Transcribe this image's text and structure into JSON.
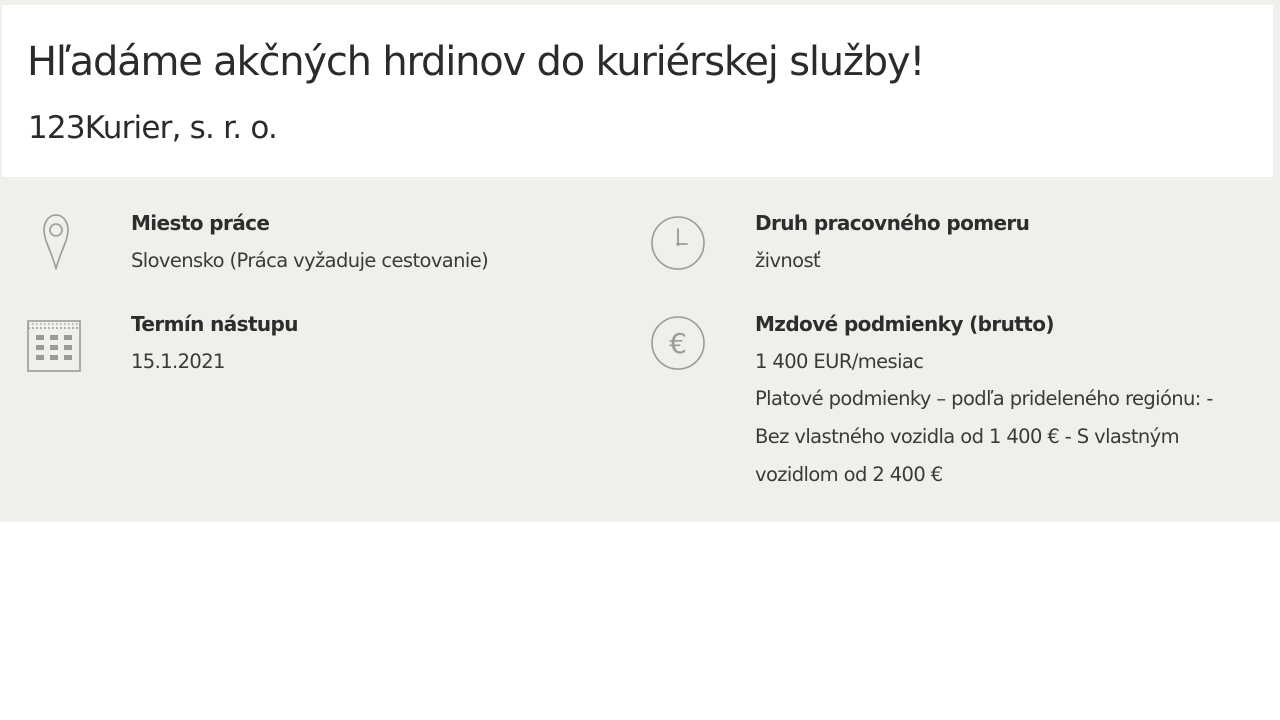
{
  "job": {
    "title": "Hľadáme akčných hrdinov do kuriérskej služby!",
    "company": "123Kurier, s. r. o."
  },
  "details": {
    "location": {
      "icon": "map-pin-icon",
      "label": "Miesto práce",
      "value": "Slovensko (Práca vyžaduje cestovanie)"
    },
    "employment_type": {
      "icon": "clock-icon",
      "label": "Druh pracovného pomeru",
      "value": "živnosť"
    },
    "start_date": {
      "icon": "calendar-icon",
      "label": "Termín nástupu",
      "value": "15.1.2021"
    },
    "salary": {
      "icon": "euro-icon",
      "label": "Mzdové podmienky (brutto)",
      "value": "1 400 EUR/mesiac",
      "note": "Platové podmienky – podľa prideleného regiónu: - Bez vlastného vozidla od 1 400 € - S vlastným vozidlom od 2 400 €"
    }
  },
  "colors": {
    "panel_background": "#efefeb",
    "header_background": "#ffffff",
    "icon_stroke": "#9a9a9a",
    "text": "#2d2d2d"
  }
}
